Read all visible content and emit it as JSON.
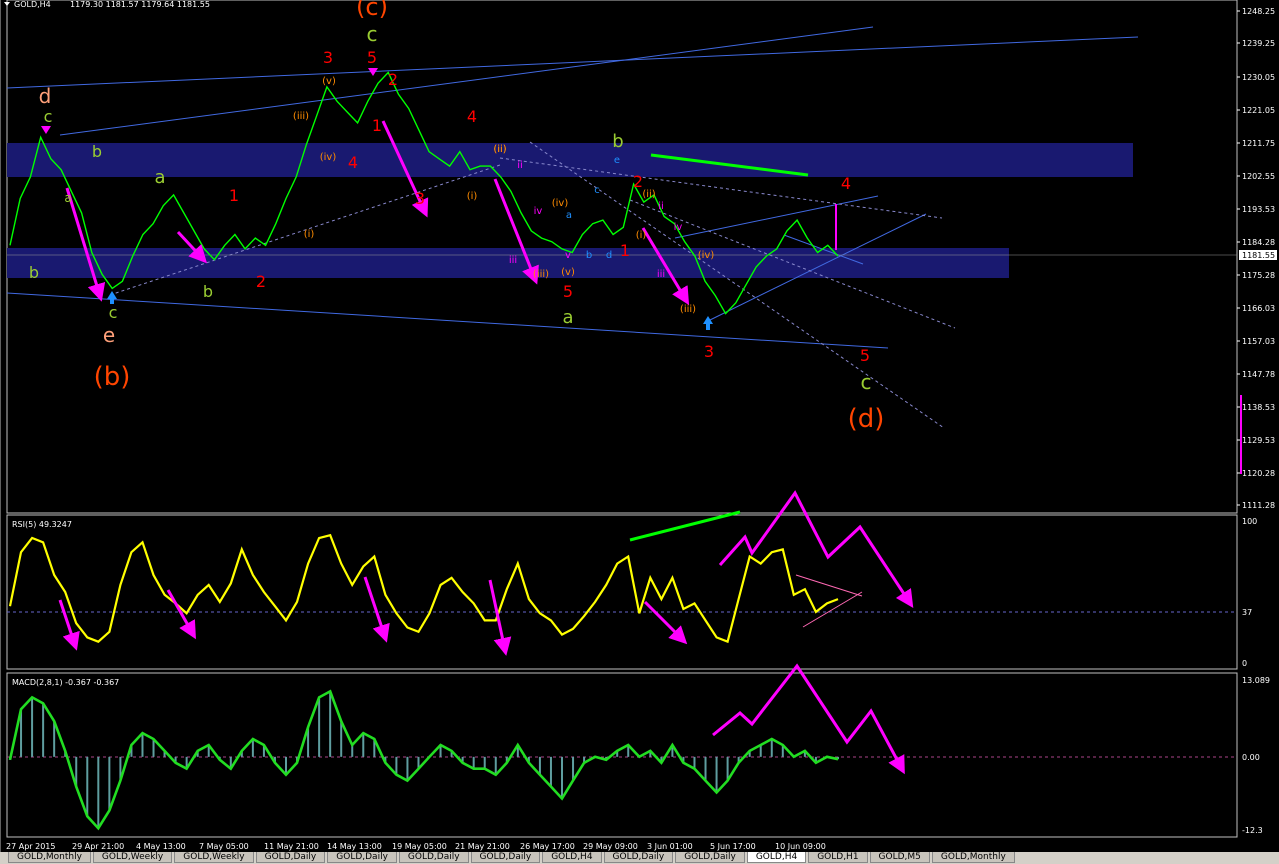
{
  "header": {
    "symbol": "GOLD,H4",
    "ohlc": "1179.30 1181.57 1179.64 1181.55"
  },
  "price_panel": {
    "current_price": "1181.55",
    "axis_ticks": [
      "1248.25",
      "1239.25",
      "1230.05",
      "1221.05",
      "1211.75",
      "1202.55",
      "1193.53",
      "1184.28",
      "1175.28",
      "1166.03",
      "1157.03",
      "1147.78",
      "1138.53",
      "1129.53",
      "1120.28",
      "1111.28"
    ],
    "wave_labels": [
      {
        "text": "(c)",
        "color": "#ff4500"
      },
      {
        "text": "c",
        "color": "#9acd32"
      },
      {
        "text": "5",
        "color": "#ff0000"
      },
      {
        "text": "3",
        "color": "#ff0000"
      },
      {
        "text": "2",
        "color": "#ff0000"
      },
      {
        "text": "1",
        "color": "#ff0000"
      },
      {
        "text": "4",
        "color": "#ff0000"
      },
      {
        "text": "3",
        "color": "#ff0000"
      },
      {
        "text": "(v)",
        "color": "#ff8c00"
      },
      {
        "text": "(iii)",
        "color": "#ff8c00"
      },
      {
        "text": "(iv)",
        "color": "#ff8c00"
      },
      {
        "text": "(i)",
        "color": "#ff8c00"
      },
      {
        "text": "(ii)",
        "color": "#ff8c00"
      },
      {
        "text": "d",
        "color": "#ffa07a"
      },
      {
        "text": "c",
        "color": "#9acd32"
      },
      {
        "text": "b",
        "color": "#9acd32"
      },
      {
        "text": "a",
        "color": "#9acd32"
      },
      {
        "text": "a",
        "color": "#9acd32"
      },
      {
        "text": "1",
        "color": "#ff0000"
      },
      {
        "text": "b",
        "color": "#9acd32"
      },
      {
        "text": "b",
        "color": "#9acd32"
      },
      {
        "text": "2",
        "color": "#ff0000"
      },
      {
        "text": "c",
        "color": "#9acd32"
      },
      {
        "text": "e",
        "color": "#ffa07a"
      },
      {
        "text": "(b)",
        "color": "#ff4500"
      },
      {
        "text": "4",
        "color": "#ff0000"
      },
      {
        "text": "(ii)",
        "color": "#ff8c00"
      },
      {
        "text": "(i)",
        "color": "#ff8c00"
      },
      {
        "text": "ii",
        "color": "#ff00ff"
      },
      {
        "text": "iv",
        "color": "#ff00ff"
      },
      {
        "text": "iii",
        "color": "#ff00ff"
      },
      {
        "text": "(iii)",
        "color": "#ff8c00"
      },
      {
        "text": "v",
        "color": "#ff00ff"
      },
      {
        "text": "(iv)",
        "color": "#ff8c00"
      },
      {
        "text": "(v)",
        "color": "#ff8c00"
      },
      {
        "text": "5",
        "color": "#ff0000"
      },
      {
        "text": "a",
        "color": "#9acd32"
      },
      {
        "text": "b",
        "color": "#9acd32"
      },
      {
        "text": "e",
        "color": "#1e90ff"
      },
      {
        "text": "c",
        "color": "#1e90ff"
      },
      {
        "text": "a",
        "color": "#1e90ff"
      },
      {
        "text": "b",
        "color": "#1e90ff"
      },
      {
        "text": "d",
        "color": "#1e90ff"
      },
      {
        "text": "2",
        "color": "#ff0000"
      },
      {
        "text": "(ii)",
        "color": "#ff8c00"
      },
      {
        "text": "ii",
        "color": "#ff00ff"
      },
      {
        "text": "(i)",
        "color": "#ff8c00"
      },
      {
        "text": "1",
        "color": "#ff0000"
      },
      {
        "text": "iv",
        "color": "#ff00ff"
      },
      {
        "text": "iii",
        "color": "#ff00ff"
      },
      {
        "text": "(iv)",
        "color": "#ff8c00"
      },
      {
        "text": "(iii)",
        "color": "#ff8c00"
      },
      {
        "text": "3",
        "color": "#ff0000"
      },
      {
        "text": "4",
        "color": "#ff0000"
      },
      {
        "text": "5",
        "color": "#ff0000"
      },
      {
        "text": "c",
        "color": "#9acd32"
      },
      {
        "text": "(d)",
        "color": "#ff4500"
      }
    ]
  },
  "rsi_panel": {
    "label": "RSI(5) 49.3247",
    "axis_ticks": [
      "100",
      "37",
      "0"
    ]
  },
  "macd_panel": {
    "label": "MACD(2,8,1) -0.367 -0.367",
    "axis_ticks": [
      "13.089",
      "0.00",
      "-12.3"
    ]
  },
  "time_axis": [
    "27 Apr 2015",
    "29 Apr 21:00",
    "4 May 13:00",
    "7 May 05:00",
    "11 May 21:00",
    "14 May 13:00",
    "19 May 05:00",
    "21 May 21:00",
    "26 May 17:00",
    "29 May 09:00",
    "3 Jun 01:00",
    "5 Jun 17:00",
    "10 Jun 09:00"
  ],
  "tabs": [
    "GOLD,Monthly",
    "GOLD,Weekly",
    "GOLD,Weekly",
    "GOLD,Daily",
    "GOLD,Daily",
    "GOLD,Daily",
    "GOLD,Daily",
    "GOLD,H4",
    "GOLD,Daily",
    "GOLD,Daily",
    "GOLD,H4",
    "GOLD,H1",
    "GOLD,M5",
    "GOLD,Monthly"
  ],
  "active_tab": 10,
  "colors": {
    "price_line": "#00ff00",
    "rsi_line": "#ffff00",
    "macd_line": "#22dd22",
    "channel": "#4169e1",
    "zone": "#191970",
    "arrow": "#ff00ff",
    "up_arrow": "#1e90ff",
    "target_line": "#00ff00"
  },
  "chart_data": [
    {
      "type": "line",
      "title": "GOLD,H4",
      "ylim": [
        1111.28,
        1248.25
      ],
      "series": [
        {
          "name": "GOLD,H4",
          "values": [
            1184,
            1197,
            1203,
            1214,
            1208,
            1205,
            1199,
            1193,
            1182,
            1176,
            1172,
            1174,
            1181,
            1187,
            1190,
            1195,
            1198,
            1193,
            1188,
            1183,
            1180,
            1184,
            1187,
            1183,
            1186,
            1184,
            1190,
            1197,
            1203,
            1212,
            1220,
            1228,
            1224,
            1221,
            1218,
            1224,
            1229,
            1232,
            1226,
            1222,
            1216,
            1210,
            1208,
            1206,
            1210,
            1205,
            1206,
            1206,
            1203,
            1199,
            1193,
            1188,
            1186,
            1185,
            1183,
            1182,
            1187,
            1190,
            1191,
            1187,
            1189,
            1201,
            1196,
            1198,
            1192,
            1190,
            1185,
            1181,
            1174,
            1170,
            1165,
            1168,
            1173,
            1178,
            1181,
            1183,
            1188,
            1191,
            1186,
            1182,
            1184,
            1181
          ]
        }
      ]
    },
    {
      "type": "line",
      "title": "RSI(5) 49.3247",
      "ylim": [
        0,
        100
      ],
      "series": [
        {
          "name": "RSI(5)",
          "values": [
            40,
            78,
            88,
            85,
            62,
            50,
            28,
            18,
            15,
            22,
            55,
            78,
            85,
            62,
            48,
            42,
            35,
            48,
            55,
            43,
            56,
            80,
            62,
            50,
            40,
            30,
            43,
            70,
            88,
            90,
            70,
            55,
            68,
            75,
            48,
            35,
            25,
            22,
            35,
            55,
            60,
            50,
            42,
            30,
            30,
            52,
            70,
            45,
            35,
            30,
            20,
            24,
            33,
            43,
            55,
            70,
            75,
            35,
            60,
            45,
            60,
            38,
            42,
            30,
            18,
            15,
            45,
            75,
            70,
            78,
            80,
            48,
            52,
            36,
            42,
            45
          ]
        }
      ]
    },
    {
      "type": "line",
      "title": "MACD(2,8,1) -0.367 -0.367",
      "ylim": [
        -12.3,
        13.089
      ],
      "series": [
        {
          "name": "MACD(2,8,1)",
          "values": [
            -0.5,
            8,
            10,
            9,
            6,
            1,
            -5,
            -10,
            -12,
            -9,
            -4,
            2,
            4,
            3,
            1,
            -1,
            -2,
            1,
            2,
            -0.5,
            -2,
            1,
            3,
            2,
            -1,
            -3,
            -1,
            5,
            10,
            11,
            6,
            2,
            4,
            3,
            -1,
            -3,
            -4,
            -2,
            0,
            2,
            1,
            -1,
            -2,
            -2,
            -3,
            -1,
            2,
            -1,
            -3,
            -5,
            -7,
            -4,
            -1,
            0,
            -0.5,
            1,
            2,
            0,
            1,
            -1,
            2,
            -1,
            -2,
            -4,
            -6,
            -4,
            -1,
            1,
            2,
            3,
            2,
            0,
            1,
            -1,
            0,
            -0.4
          ]
        }
      ]
    }
  ]
}
